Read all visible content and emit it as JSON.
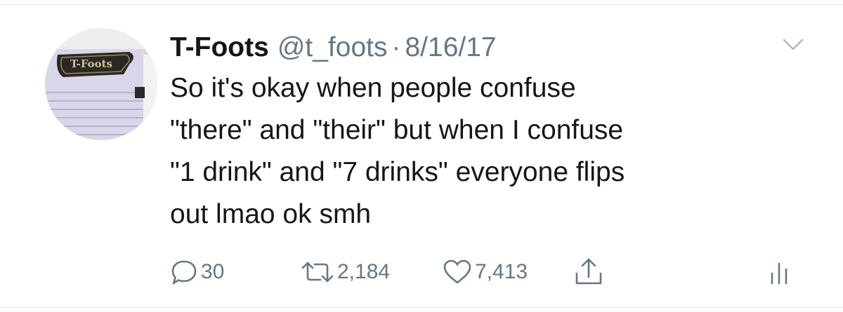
{
  "tweet": {
    "author": {
      "display_name": "T-Foots",
      "handle": "@t_foots",
      "avatar_sign_text": "T-Foots"
    },
    "separator": "·",
    "date": "8/16/17",
    "text": "So it's okay when people confuse\n\"there\" and \"their\" but when I confuse\n\"1 drink\" and \"7 drinks\" everyone flips\nout lmao ok smh",
    "actions": {
      "reply_count": "30",
      "retweet_count": "2,184",
      "like_count": "7,413"
    }
  },
  "icons": {
    "caret": "chevron-down-icon",
    "reply": "reply-bubble-icon",
    "retweet": "retweet-icon",
    "like": "heart-icon",
    "share": "share-icon",
    "analytics": "analytics-icon"
  },
  "colors": {
    "text": "#14171a",
    "secondary": "#657786",
    "divider": "#e6ecf0"
  }
}
